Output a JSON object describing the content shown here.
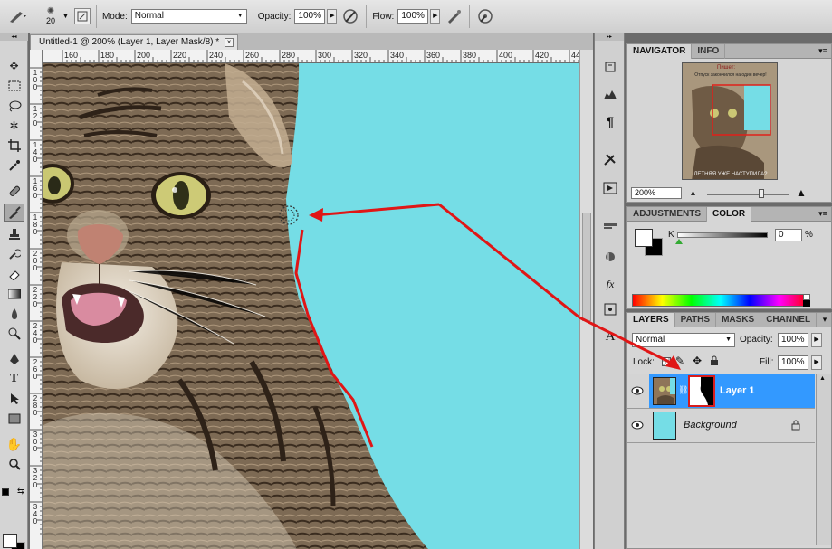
{
  "options_bar": {
    "brush_size": "20",
    "mode_label": "Mode:",
    "mode_value": "Normal",
    "opacity_label": "Opacity:",
    "opacity_value": "100%",
    "flow_label": "Flow:",
    "flow_value": "100%"
  },
  "document": {
    "tab_title": "Untitled-1 @ 200% (Layer 1, Layer Mask/8) *",
    "close_glyph": "×",
    "ruler_h_labels": [
      "160",
      "180",
      "200",
      "220",
      "240",
      "260",
      "280",
      "300",
      "320",
      "340",
      "360",
      "380",
      "400",
      "420",
      "44"
    ],
    "ruler_v_labels": [
      "100",
      "120",
      "140",
      "160",
      "180",
      "200",
      "220",
      "240",
      "260",
      "280",
      "300",
      "320",
      "340"
    ]
  },
  "navigator": {
    "tabs": [
      "NAVIGATOR",
      "INFO"
    ],
    "zoom_value": "200%",
    "thumb_caption_top": "Пишет:",
    "thumb_caption_mid": "Отпуск закончился на один вечер!",
    "thumb_caption_bottom": "ЛЕТНЯЯ УЖЕ НАСТУПИЛА?"
  },
  "color_panel": {
    "tabs": [
      "ADJUSTMENTS",
      "COLOR"
    ],
    "channel_label": "K",
    "channel_value": "0",
    "unit": "%"
  },
  "layers_panel": {
    "tabs": [
      "LAYERS",
      "PATHS",
      "MASKS",
      "CHANNEL"
    ],
    "blend_mode": "Normal",
    "opacity_label": "Opacity:",
    "opacity_value": "100%",
    "lock_label": "Lock:",
    "fill_label": "Fill:",
    "fill_value": "100%",
    "layers": [
      {
        "name": "Layer 1"
      },
      {
        "name": "Background"
      }
    ]
  },
  "colors": {
    "canvas_bg": "#75dde6",
    "selection": "#3399ff",
    "annotation": "#e01616"
  }
}
